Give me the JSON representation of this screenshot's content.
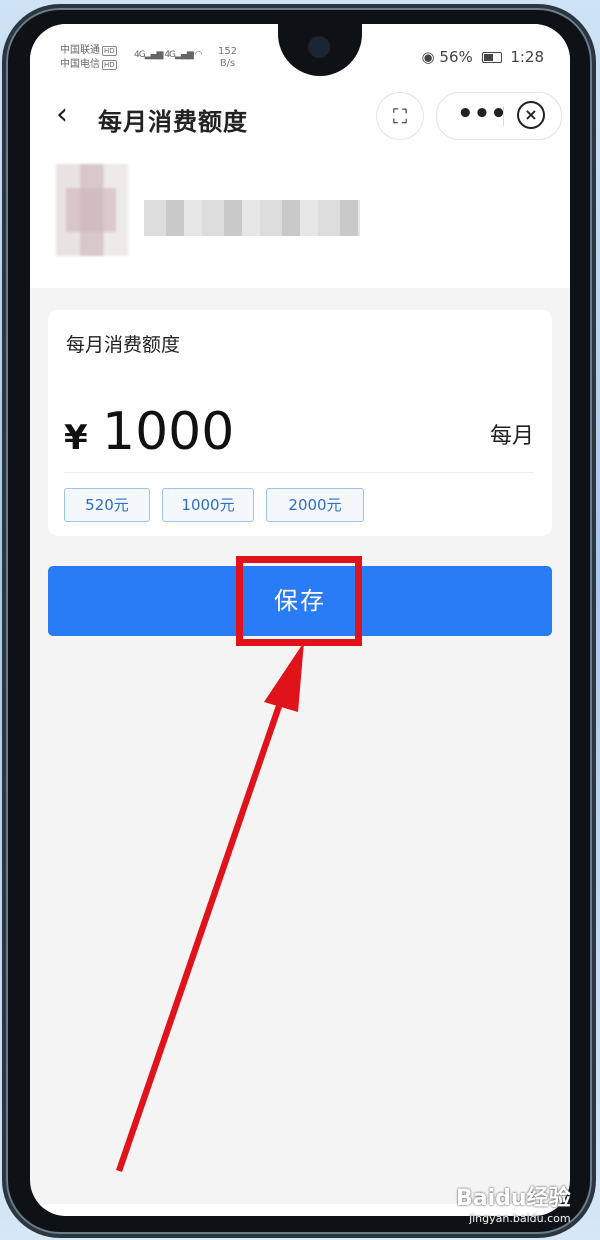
{
  "status_bar": {
    "carrier1": "中国联通",
    "carrier2": "中国电信",
    "hd": "HD",
    "signal1": "4G",
    "signal2": "4G",
    "speed_value": "152",
    "speed_unit": "B/s",
    "battery_percent": "56%",
    "time": "1:28"
  },
  "nav": {
    "back_icon": "chevron-left-icon",
    "title": "每月消费额度",
    "scan_icon": "scan-icon",
    "more_icon": "more-horizontal-icon",
    "close_icon": "close-circle-icon"
  },
  "card": {
    "title": "每月消费额度",
    "currency": "¥",
    "amount": "1000",
    "period": "每月",
    "options": [
      "520元",
      "1000元",
      "2000元"
    ]
  },
  "save_label": "保存",
  "colors": {
    "primary": "#2a7cf6",
    "highlight": "#e0121a",
    "chip_text": "#2b6fc4",
    "chip_border": "#9cc3ef"
  },
  "watermark": {
    "logo": "Baidu经验",
    "url": "jingyan.baidu.com"
  }
}
